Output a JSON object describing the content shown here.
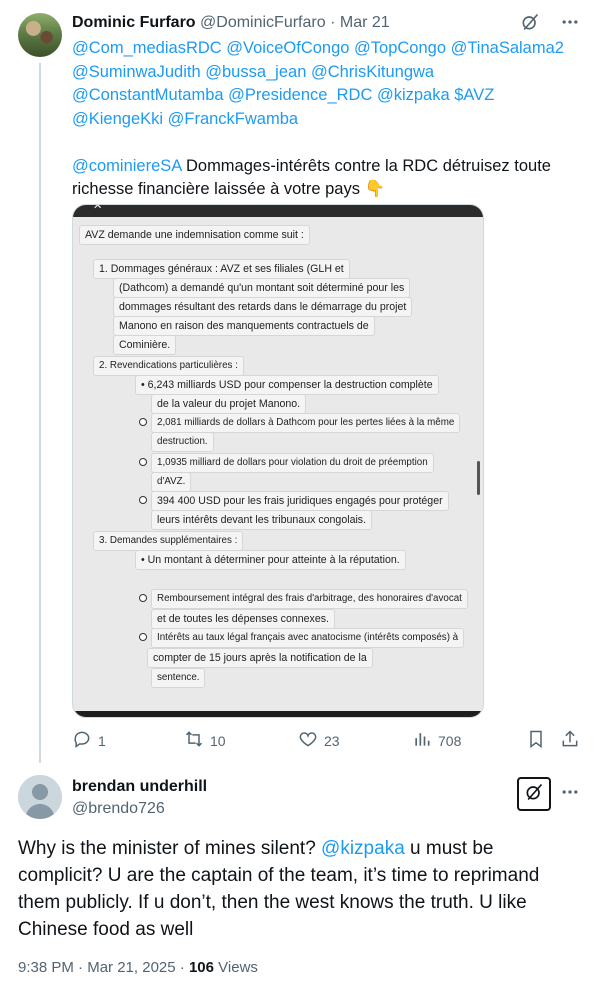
{
  "tweet1": {
    "author_name": "Dominic Furfaro",
    "author_handle": "@DominicFurfaro",
    "separator": "·",
    "date": "Mar 21",
    "mentions_lines": [
      "@Com_mediasRDC @VoiceOfCongo @TopCongo @TinaSalama2",
      "@SuminwaJudith @bussa_jean @ChrisKitungwa",
      "@ConstantMutamba @Presidence_RDC @kizpaka $AVZ",
      "@KiengeKki @FranckFwamba"
    ],
    "body_mention": "@cominiereSA",
    "body_text_line1": " Dommages-intérêts contre la RDC détruisez toute",
    "body_text_line2": "richesse financière laissée à votre pays",
    "body_emoji": "👇",
    "media": {
      "heading": "AVZ demande une indemnisation comme suit :",
      "item1_l1": "1. Dommages généraux : AVZ et ses filiales (GLH et",
      "item1_l2": "(Dathcom) a demandé qu'un montant soit déterminé pour les",
      "item1_l3": "dommages résultant des retards dans le démarrage du projet",
      "item1_l4": "Manono en raison des manquements contractuels de",
      "item1_l5": "Cominière.",
      "item2": "2. Revendications particulières :",
      "item2_b1_l1": "• 6,243 milliards USD pour compenser la destruction complète",
      "item2_b1_l2": "de la valeur du projet Manono.",
      "item2_b2_l1": "2,081 milliards de dollars à Dathcom pour les pertes liées à la même",
      "item2_b2_l2": "destruction.",
      "item2_b3_l1": "1,0935 milliard de dollars pour violation du droit de préemption",
      "item2_b3_l2": "d'AVZ.",
      "item2_b4_l1": "394 400 USD pour les frais juridiques engagés pour protéger",
      "item2_b4_l2": "leurs intérêts devant les tribunaux congolais.",
      "item3": "3. Demandes supplémentaires :",
      "item3_b1": "• Un montant à déterminer pour atteinte à la réputation.",
      "item3_b2_l1": "Remboursement intégral des frais d'arbitrage, des honoraires d'avocat",
      "item3_b2_l2": "et de toutes les dépenses connexes.",
      "item3_b3_l1": "Intérêts au taux légal français avec anatocisme (intérêts composés) à",
      "item3_b3_l2": "compter de 15 jours après la notification de la",
      "item3_b3_l3": "sentence."
    },
    "actions": {
      "replies": "1",
      "reposts": "10",
      "likes": "23",
      "views": "708"
    }
  },
  "tweet2": {
    "author_name": "brendan underhill",
    "author_handle": "@brendo726",
    "text_part1": "Why is the minister of mines silent? ",
    "text_mention": "@kizpaka",
    "text_part2": " u must be complicit? U are the captain of the team, it’s time to reprimand them publicly. If u don’t, then the west knows the truth. U like Chinese food as well",
    "time": "9:38 PM",
    "separator": "·",
    "date": "Mar 21, 2025",
    "separator2": "·",
    "views_count": "106",
    "views_label": "Views"
  },
  "colors": {
    "link": "#1d9bf0",
    "secondary_text": "#536471",
    "thread_line": "#cfd9de"
  },
  "icons": [
    "grok-icon",
    "more-icon",
    "reply-icon",
    "repost-icon",
    "like-icon",
    "views-icon",
    "bookmark-icon",
    "share-icon"
  ]
}
